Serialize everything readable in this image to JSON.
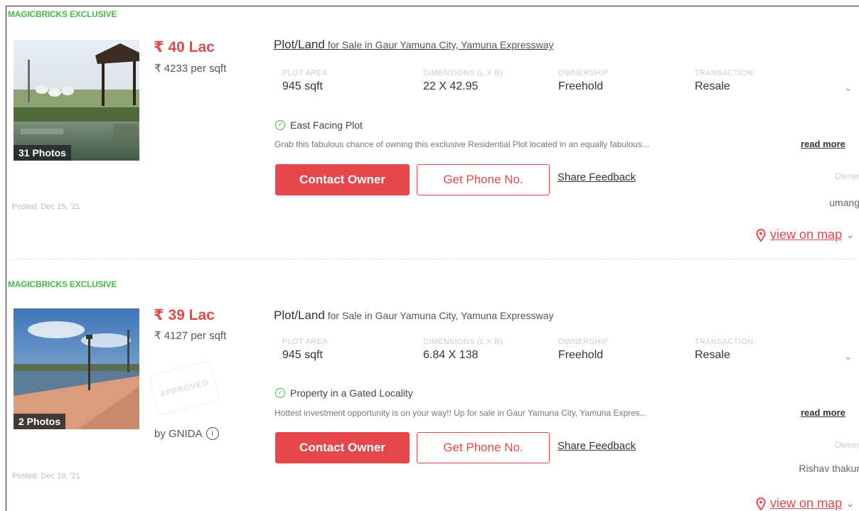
{
  "listings": [
    {
      "badge": "MAGICBRICKS EXCLUSIVE",
      "photos": "31 Photos",
      "posted": "Posted: Dec 15, '21",
      "price": "₹ 40 Lac",
      "per_sqft": "₹ 4233 per sqft",
      "title_type": "Plot/Land",
      "title_rest": " for Sale in Gaur Yamuna City, Yamuna Expressway",
      "attributes": [
        {
          "label": "PLOT AREA",
          "value": "945 sqft"
        },
        {
          "label": "DIMENSIONS (L X B)",
          "value": "22 X 42.95"
        },
        {
          "label": "OWNERSHIP",
          "value": "Freehold"
        },
        {
          "label": "TRANSACTION",
          "value": "Resale"
        }
      ],
      "highlight": "East Facing Plot",
      "description": "Grab this fabulous chance of owning this exclusive Residential Plot located in an equally fabulous...",
      "read_more": "read more",
      "contact_label": "Contact Owner",
      "phone_label": "Get Phone No.",
      "feedback_label": "Share Feedback",
      "owner_label": "Owner",
      "owner_name": "umang",
      "map_label": "view on map"
    },
    {
      "badge": "MAGICBRICKS EXCLUSIVE",
      "photos": "2 Photos",
      "posted": "Posted: Dec 19, '21",
      "price": "₹ 39 Lac",
      "per_sqft": "₹ 4127 per sqft",
      "approval": "by GNIDA",
      "title_type": "Plot/Land",
      "title_rest": " for Sale in Gaur Yamuna City, Yamuna Expressway",
      "attributes": [
        {
          "label": "PLOT AREA",
          "value": "945 sqft"
        },
        {
          "label": "DIMENSIONS (L X B)",
          "value": "6.84 X 138"
        },
        {
          "label": "OWNERSHIP",
          "value": "Freehold"
        },
        {
          "label": "TRANSACTION",
          "value": "Resale"
        }
      ],
      "highlight": "Property in a Gated Locality",
      "description": "Hottest investment opportunity is on your way!! Up for sale in Gaur Yamuna City, Yamuna Expres...",
      "read_more": "read more",
      "contact_label": "Contact Owner",
      "phone_label": "Get Phone No.",
      "feedback_label": "Share Feedback",
      "owner_label": "Owner",
      "owner_name": "Rishav thakur",
      "map_label": "view on map"
    }
  ],
  "colors": {
    "accent": "#e5474b",
    "exclusive": "#49b64a"
  },
  "icons": {
    "check": "check-circle-icon",
    "chevron": "chevron-down-icon",
    "pin": "map-pin-icon",
    "info": "info-icon"
  }
}
